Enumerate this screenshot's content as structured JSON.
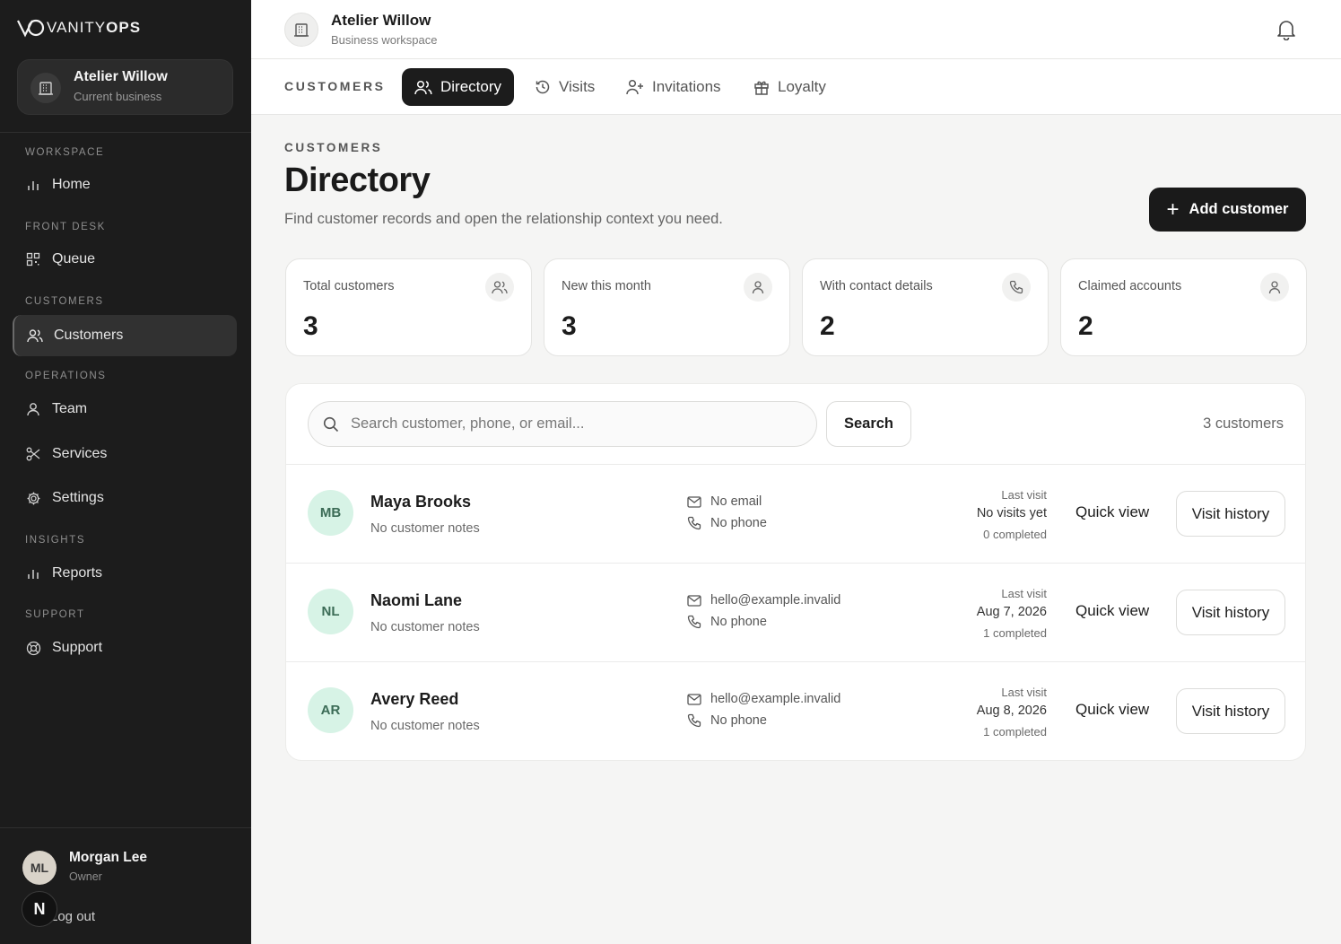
{
  "brand": {
    "logo_left": "VANITY",
    "logo_right": "OPS"
  },
  "sidebar": {
    "business": {
      "name": "Atelier Willow",
      "sub": "Current business"
    },
    "sections": [
      {
        "label": "WORKSPACE",
        "items": [
          {
            "label": "Home",
            "icon": "bar-chart-icon"
          }
        ]
      },
      {
        "label": "FRONT DESK",
        "items": [
          {
            "label": "Queue",
            "icon": "qr-grid-icon"
          }
        ]
      },
      {
        "label": "CUSTOMERS",
        "items": [
          {
            "label": "Customers",
            "icon": "users-icon",
            "active": true
          }
        ]
      },
      {
        "label": "OPERATIONS",
        "items": [
          {
            "label": "Team",
            "icon": "user-icon"
          },
          {
            "label": "Services",
            "icon": "scissors-icon"
          },
          {
            "label": "Settings",
            "icon": "gear-icon"
          }
        ]
      },
      {
        "label": "INSIGHTS",
        "items": [
          {
            "label": "Reports",
            "icon": "bar-chart-icon"
          }
        ]
      },
      {
        "label": "SUPPORT",
        "items": [
          {
            "label": "Support",
            "icon": "lifebuoy-icon"
          }
        ]
      }
    ],
    "user": {
      "initials": "ML",
      "name": "Morgan Lee",
      "role": "Owner",
      "badge": "N",
      "logout": "Log out"
    }
  },
  "header": {
    "title": "Atelier Willow",
    "subtitle": "Business workspace"
  },
  "tabs": {
    "heading": "CUSTOMERS",
    "items": [
      {
        "label": "Directory",
        "icon": "users-icon",
        "active": true
      },
      {
        "label": "Visits",
        "icon": "history-icon"
      },
      {
        "label": "Invitations",
        "icon": "user-plus-icon"
      },
      {
        "label": "Loyalty",
        "icon": "gift-icon"
      }
    ]
  },
  "main": {
    "eyebrow": "CUSTOMERS",
    "title": "Directory",
    "subtitle": "Find customer records and open the relationship context you need.",
    "add_button": "Add customer"
  },
  "stats": [
    {
      "label": "Total customers",
      "value": "3",
      "icon": "users-icon"
    },
    {
      "label": "New this month",
      "value": "3",
      "icon": "user-icon"
    },
    {
      "label": "With contact details",
      "value": "2",
      "icon": "phone-icon"
    },
    {
      "label": "Claimed accounts",
      "value": "2",
      "icon": "user-icon"
    }
  ],
  "search": {
    "placeholder": "Search customer, phone, or email...",
    "button": "Search",
    "count": "3 customers"
  },
  "customers": [
    {
      "initials": "MB",
      "name": "Maya Brooks",
      "notes": "No customer notes",
      "email": "No email",
      "phone": "No phone",
      "last_visit_label": "Last visit",
      "last_visit": "No visits yet",
      "completed": "0 completed",
      "quick": "Quick view",
      "history": "Visit history"
    },
    {
      "initials": "NL",
      "name": "Naomi Lane",
      "notes": "No customer notes",
      "email": "hello@example.invalid",
      "phone": "No phone",
      "last_visit_label": "Last visit",
      "last_visit": "Aug 7, 2026",
      "completed": "1 completed",
      "quick": "Quick view",
      "history": "Visit history"
    },
    {
      "initials": "AR",
      "name": "Avery Reed",
      "notes": "No customer notes",
      "email": "hello@example.invalid",
      "phone": "No phone",
      "last_visit_label": "Last visit",
      "last_visit": "Aug 8, 2026",
      "completed": "1 completed",
      "quick": "Quick view",
      "history": "Visit history"
    }
  ]
}
